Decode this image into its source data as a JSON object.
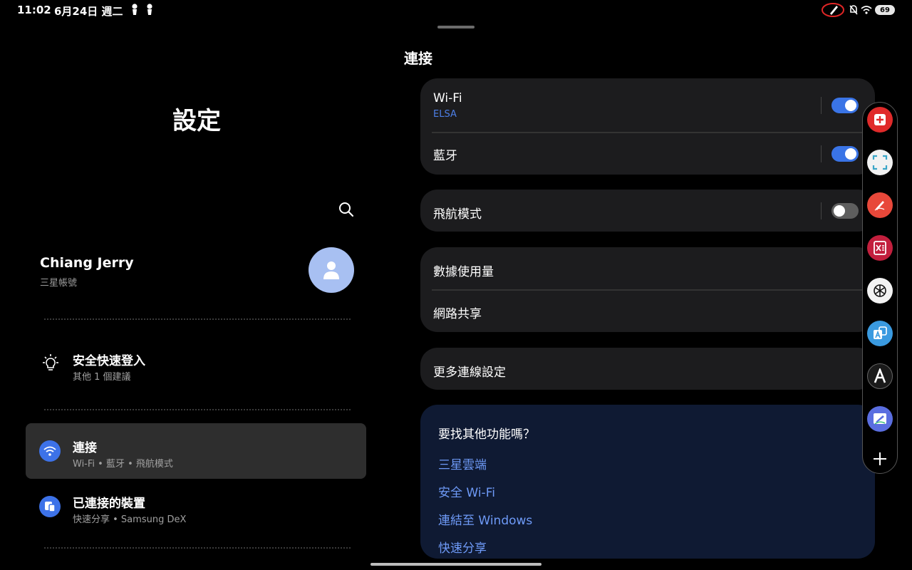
{
  "status_bar": {
    "time": "11:02",
    "date": "6月24日 週二",
    "battery": "69",
    "icons": [
      "notification-icon",
      "notification-icon",
      "pen-icon",
      "mute-icon",
      "wifi-icon",
      "battery-icon"
    ]
  },
  "left": {
    "title": "設定",
    "profile": {
      "name": "Chiang Jerry",
      "subtitle": "三星帳號"
    },
    "tip": {
      "title": "安全快速登入",
      "subtitle": "其他 1 個建議"
    },
    "menu": [
      {
        "title": "連接",
        "subtitle": "Wi-Fi • 藍牙 • 飛航模式",
        "icon": "wifi-icon",
        "active": true
      },
      {
        "title": "已連接的裝置",
        "subtitle": "快速分享 • Samsung DeX",
        "icon": "devices-icon",
        "active": false
      }
    ]
  },
  "right": {
    "title": "連接",
    "wifi": {
      "label": "Wi-Fi",
      "network": "ELSA",
      "on": true
    },
    "bluetooth": {
      "label": "藍牙",
      "on": true
    },
    "airplane": {
      "label": "飛航模式",
      "on": false
    },
    "data_usage": "數據使用量",
    "hotspot": "網路共享",
    "more": "更多連線設定",
    "suggest": {
      "title": "要找其他功能嗎？",
      "links": [
        "三星雲端",
        "安全 Wi-Fi",
        "連結至 Windows",
        "快速分享"
      ]
    }
  },
  "edge_panel": {
    "apps": [
      "add-note-icon",
      "screen-capture-icon",
      "pen-app-icon",
      "office-app-icon",
      "chatgpt-icon",
      "translate-icon",
      "font-app-icon",
      "whiteboard-icon"
    ],
    "colors": {
      "accent": "#3a74e6",
      "link": "#6e9af7",
      "card": "#1c1c1e",
      "suggest_bg": "#0f1a33"
    }
  }
}
